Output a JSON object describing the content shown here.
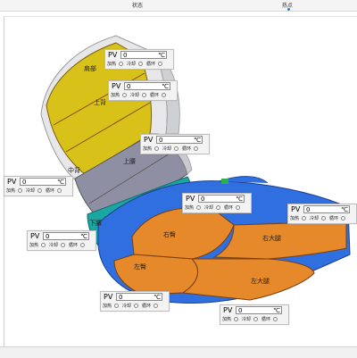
{
  "toolbar": {
    "state_label": "状态",
    "hotspot_label": "热点"
  },
  "zones": [
    {
      "id": "shoulder",
      "label": "肩部"
    },
    {
      "id": "upper-back",
      "label": "上背"
    },
    {
      "id": "mid-back",
      "label": "中背"
    },
    {
      "id": "upper-waist",
      "label": "上腰"
    },
    {
      "id": "lower-waist",
      "label": "下腰"
    },
    {
      "id": "right-hip",
      "label": "右臀"
    },
    {
      "id": "left-hip",
      "label": "左臀"
    },
    {
      "id": "right-thigh",
      "label": "右大腿"
    },
    {
      "id": "left-thigh",
      "label": "左大腿"
    }
  ],
  "panels": [
    {
      "id": "p1",
      "pv_label": "PV",
      "value": "0",
      "unit": "℃",
      "options": [
        "加热",
        "冷却",
        "循环"
      ]
    },
    {
      "id": "p2",
      "pv_label": "PV",
      "value": "0",
      "unit": "℃",
      "options": [
        "加热",
        "冷却",
        "循环"
      ]
    },
    {
      "id": "p3",
      "pv_label": "PV",
      "value": "0",
      "unit": "℃",
      "options": [
        "加热",
        "冷却",
        "循环"
      ]
    },
    {
      "id": "p4",
      "pv_label": "PV",
      "value": "0",
      "unit": "℃",
      "options": [
        "加热",
        "冷却",
        "循环"
      ]
    },
    {
      "id": "p5",
      "pv_label": "PV",
      "value": "0",
      "unit": "℃",
      "options": [
        "加热",
        "冷却",
        "循环"
      ]
    },
    {
      "id": "p6",
      "pv_label": "PV",
      "value": "0",
      "unit": "℃",
      "options": [
        "加热",
        "冷却",
        "循环"
      ]
    },
    {
      "id": "p7",
      "pv_label": "PV",
      "value": "0",
      "unit": "℃",
      "options": [
        "加热",
        "冷却",
        "循环"
      ]
    },
    {
      "id": "p8",
      "pv_label": "PV",
      "value": "0",
      "unit": "℃",
      "options": [
        "加热",
        "冷却",
        "循环"
      ]
    }
  ],
  "colors": {
    "back_yellow": "#d8c21a",
    "waist_gray": "#8f8fa3",
    "hip_orange": "#e5892a",
    "base_blue": "#2f6fe0",
    "accent_teal": "#1aa7a2"
  }
}
